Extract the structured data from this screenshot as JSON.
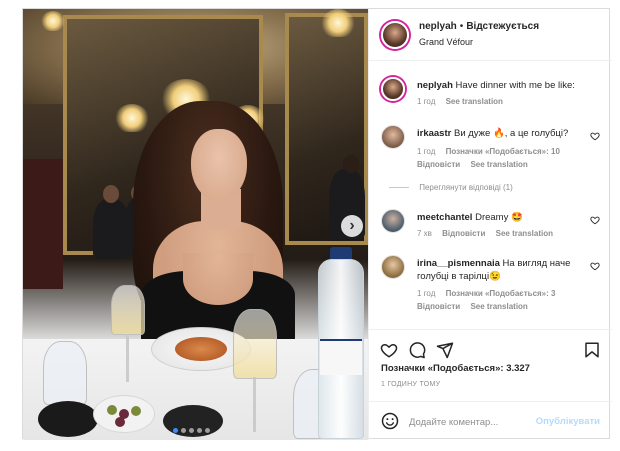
{
  "header": {
    "username": "neplyah",
    "separator": "•",
    "follow_status": "Відстежується",
    "location": "Grand Véfour"
  },
  "caption": {
    "username": "neplyah",
    "text": "Have dinner with me be like:",
    "time": "1 год",
    "translate": "See translation"
  },
  "comments": [
    {
      "username": "irkaastr",
      "text": "Ви дуже 🔥, а це голубці?",
      "time": "1 год",
      "likes": "Позначки «Подобається»: 10",
      "reply": "Відповісти",
      "translate": "See translation"
    },
    {
      "view_replies": "Переглянути відповіді (1)"
    },
    {
      "username": "meetchantel",
      "text": "Dreamy 🤩",
      "time": "7 хв",
      "reply": "Відповісти",
      "translate": "See translation"
    },
    {
      "username": "irina__pismennaia",
      "text": "На вигляд наче голубці в тарілці😉",
      "time": "1 год",
      "likes": "Позначки «Подобається»: 3",
      "reply": "Відповісти",
      "translate": "See translation"
    }
  ],
  "post": {
    "likes": "Позначки «Подобається»: 3.327",
    "time": "1 ГОДИНУ ТОМУ"
  },
  "add_comment": {
    "placeholder": "Додайте коментар...",
    "publish": "Опублікувати"
  },
  "carousel": {
    "next_glyph": "›",
    "slide_count": 5,
    "active_slide": 1
  },
  "icons": [
    "heart-icon",
    "comment-icon",
    "share-icon",
    "bookmark-icon",
    "emoji-icon",
    "chevron-right-icon"
  ],
  "colors": {
    "border": "#dbdbdb",
    "muted": "#8e8e8e",
    "publish": "#b3dbff",
    "text": "#262626"
  }
}
